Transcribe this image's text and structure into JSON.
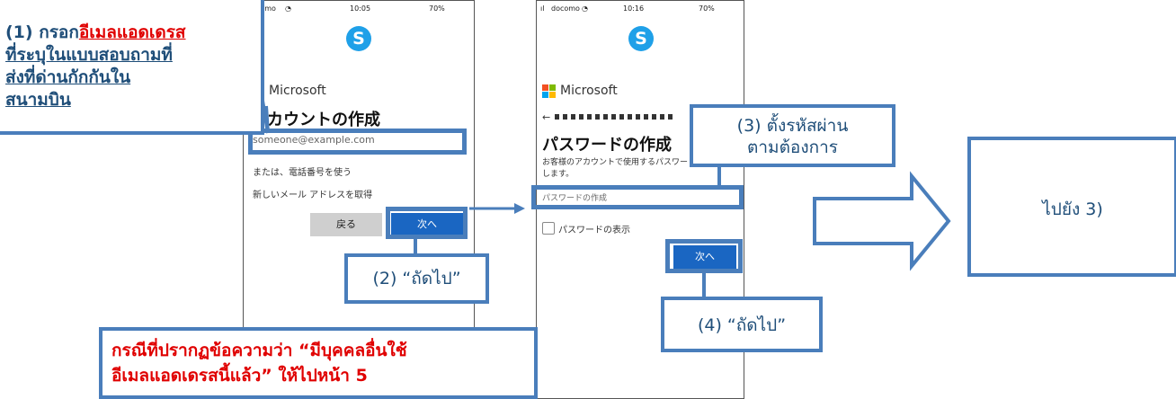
{
  "phone1": {
    "status_carrier": "docomo",
    "status_time": "10:05",
    "status_battery": "70%",
    "skype_letter": "S",
    "ms_brand": "Microsoft",
    "title": "アカウントの作成",
    "email_placeholder": "someone@example.com",
    "link_phone": "または、電話番号を使う",
    "link_new_email": "新しいメール アドレスを取得",
    "back_label": "戻る",
    "next_label": "次へ"
  },
  "phone2": {
    "status_carrier": "docomo",
    "status_time": "10:16",
    "status_battery": "70%",
    "skype_letter": "S",
    "ms_brand": "Microsoft",
    "title": "パスワードの作成",
    "description": "お客様のアカウントで使用するパスワードを入力します。",
    "password_placeholder": "パスワードの作成",
    "show_password_label": "パスワードの表示",
    "next_label": "次へ"
  },
  "callouts": {
    "step1_prefix": "(1) กรอก",
    "step1_highlight": "อีเมลแอดเดรส",
    "step1_line2": "ที่ระบุในแบบสอบถามที่",
    "step1_line3": "ส่งที่ด่านกักกันใน",
    "step1_line4": "สนามบิน",
    "step2": "(2) “ถัดไป”",
    "step3_line1": "(3) ตั้งรหัสผ่าน",
    "step3_line2": "ตามต้องการ",
    "step4": "(4) “ถัดไป”",
    "note_line1": "กรณีที่ปรากฏข้อความว่า “มีบุคคลอื่นใช้",
    "note_line2": "อีเมลแอดเดรสนี้แล้ว” ให้ไปหน้า 5",
    "goto": "ไปยัง 3)"
  },
  "colors": {
    "accent": "#4a7ebb",
    "callout_text": "#1f4e79",
    "note_text": "#e00000",
    "skype_blue": "#1fa0e8",
    "ms_button_blue": "#1a66c2"
  }
}
